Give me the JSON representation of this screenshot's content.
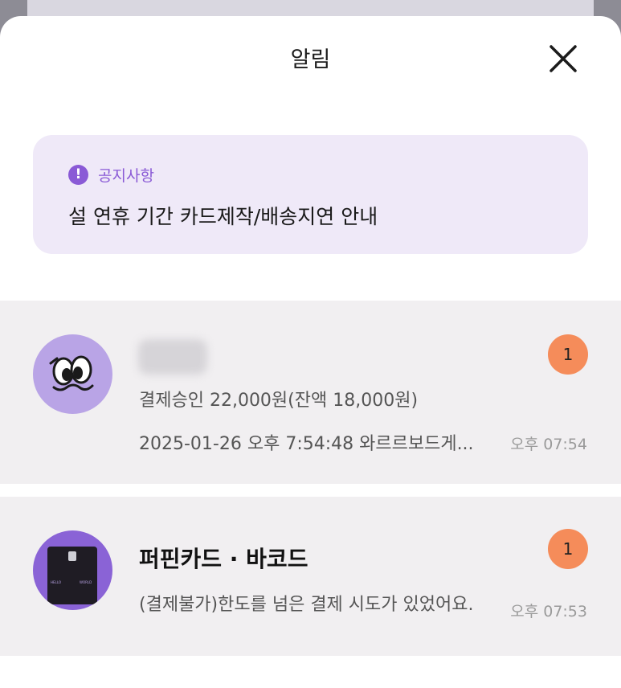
{
  "header": {
    "title": "알림"
  },
  "notice": {
    "tag": "공지사항",
    "text": "설 연휴 기간 카드제작/배송지연 안내"
  },
  "notifications": [
    {
      "sender": "",
      "line1": "결제승인 22,000원(잔액 18,000원)",
      "line2": "2025-01-26 오후 7:54:48 와르르보드게...",
      "time": "오후 07:54",
      "badge": "1"
    },
    {
      "sender": "퍼핀카드 · 바코드",
      "line1": "(결제불가)한도를 넘은 결제 시도가 있었어요.",
      "time": "오후 07:53",
      "badge": "1"
    }
  ],
  "colors": {
    "accent": "#8a5ad6",
    "notice_bg": "#efe9f8",
    "badge": "#f58c5a",
    "row_bg": "#f1eff1"
  },
  "icons": [
    "close-icon",
    "exclamation-icon",
    "cartoon-eyes-avatar-icon",
    "card-avatar-icon"
  ]
}
